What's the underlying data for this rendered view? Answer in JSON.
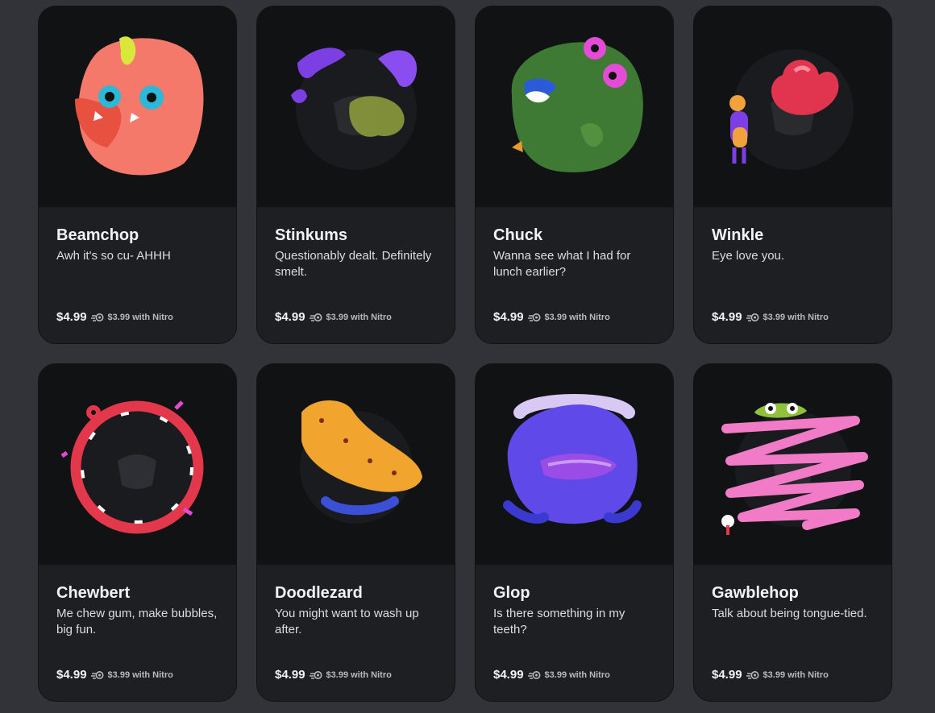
{
  "products": [
    {
      "name": "Beamchop",
      "description": "Awh it's so cu- AHHH",
      "price": "$4.99",
      "nitro_price": "$3.99 with Nitro",
      "art": "pink-blob-monster"
    },
    {
      "name": "Stinkums",
      "description": "Questionably dealt. Definitely smelt.",
      "price": "$4.99",
      "nitro_price": "$3.99 with Nitro",
      "art": "purple-worm-stink-cloud"
    },
    {
      "name": "Chuck",
      "description": "Wanna see what I had for lunch earlier?",
      "price": "$4.99",
      "nitro_price": "$3.99 with Nitro",
      "art": "green-blob-monster"
    },
    {
      "name": "Winkle",
      "description": "Eye love you.",
      "price": "$4.99",
      "nitro_price": "$3.99 with Nitro",
      "art": "heart-balloon-creature"
    },
    {
      "name": "Chewbert",
      "description": "Me chew gum, make bubbles, big fun.",
      "price": "$4.99",
      "nitro_price": "$3.99 with Nitro",
      "art": "red-ring-mouth"
    },
    {
      "name": "Doodlezard",
      "description": "You might want to wash up after.",
      "price": "$4.99",
      "nitro_price": "$3.99 with Nitro",
      "art": "orange-lizard"
    },
    {
      "name": "Glop",
      "description": "Is there something in my teeth?",
      "price": "$4.99",
      "nitro_price": "$3.99 with Nitro",
      "art": "purple-blob-smile"
    },
    {
      "name": "Gawblehop",
      "description": "Talk about being tongue-tied.",
      "price": "$4.99",
      "nitro_price": "$3.99 with Nitro",
      "art": "pink-tongue-tangle"
    }
  ]
}
